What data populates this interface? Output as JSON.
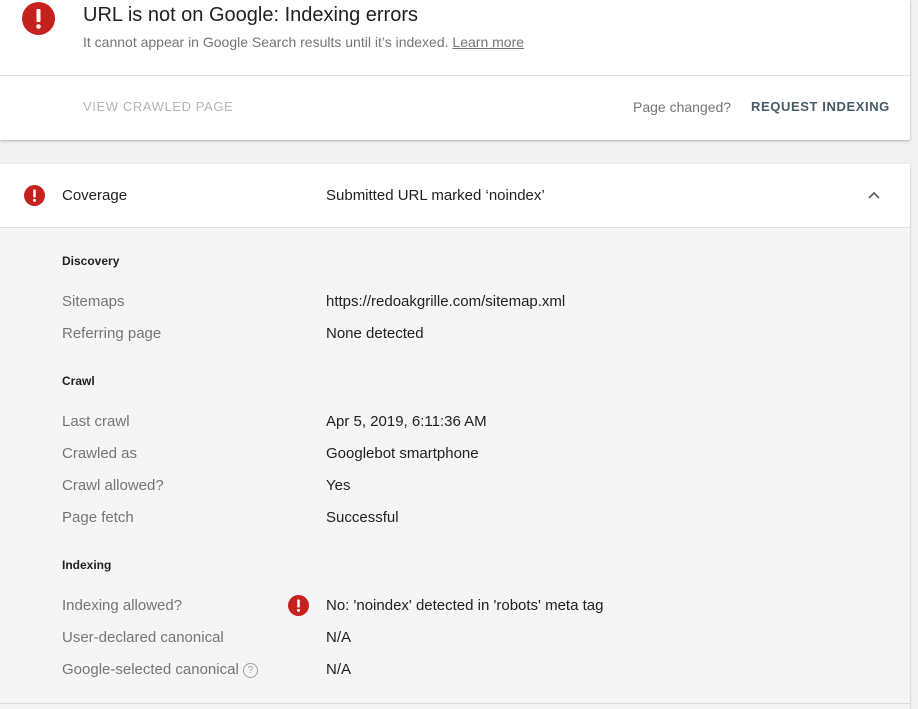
{
  "status": {
    "title": "URL is not on Google: Indexing errors",
    "subtitle": "It cannot appear in Google Search results until it’s indexed.",
    "learn_more": "Learn more",
    "icon": "error-icon",
    "icon_color": "#c5221f"
  },
  "actions": {
    "view_crawled": "VIEW CRAWLED PAGE",
    "page_changed": "Page changed?",
    "request_indexing": "REQUEST INDEXING"
  },
  "coverage": {
    "label": "Coverage",
    "value": "Submitted URL marked ‘noindex’",
    "expanded": true,
    "sections": {
      "discovery": {
        "title": "Discovery",
        "rows": [
          {
            "label": "Sitemaps",
            "value": "https://redoakgrille.com/sitemap.xml"
          },
          {
            "label": "Referring page",
            "value": "None detected"
          }
        ]
      },
      "crawl": {
        "title": "Crawl",
        "rows": [
          {
            "label": "Last crawl",
            "value": "Apr 5, 2019, 6:11:36 AM"
          },
          {
            "label": "Crawled as",
            "value": "Googlebot smartphone"
          },
          {
            "label": "Crawl allowed?",
            "value": "Yes"
          },
          {
            "label": "Page fetch",
            "value": "Successful"
          }
        ]
      },
      "indexing": {
        "title": "Indexing",
        "rows": [
          {
            "label": "Indexing allowed?",
            "value": "No: 'noindex' detected in 'robots' meta tag",
            "error": true
          },
          {
            "label": "User-declared canonical",
            "value": "N/A"
          },
          {
            "label": "Google-selected canonical",
            "value": "N/A",
            "help": true
          }
        ]
      }
    }
  }
}
